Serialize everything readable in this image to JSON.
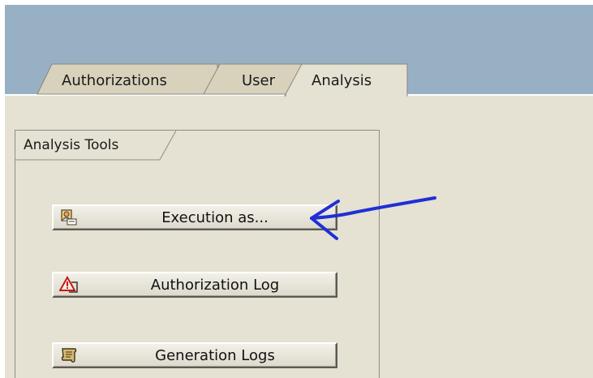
{
  "tabs": [
    {
      "label": "Authorizations",
      "active": false
    },
    {
      "label": "User",
      "active": false
    },
    {
      "label": "Analysis",
      "active": true
    }
  ],
  "analysis_tools": {
    "title": "Analysis Tools",
    "buttons": [
      {
        "label": "Execution as...",
        "icon": "user-execute-icon"
      },
      {
        "label": "Authorization Log",
        "icon": "warning-log-icon"
      },
      {
        "label": "Generation Logs",
        "icon": "scroll-log-icon"
      }
    ]
  },
  "annotation": {
    "type": "hand-drawn arrow",
    "color": "#1f2fd6",
    "points_to": "Execution as..."
  },
  "colors": {
    "title_band": "#97b0c3",
    "panel_background": "#e5e1d3",
    "tab_active": "#e5e1d3",
    "tab_inactive": "#d8d2bc"
  }
}
